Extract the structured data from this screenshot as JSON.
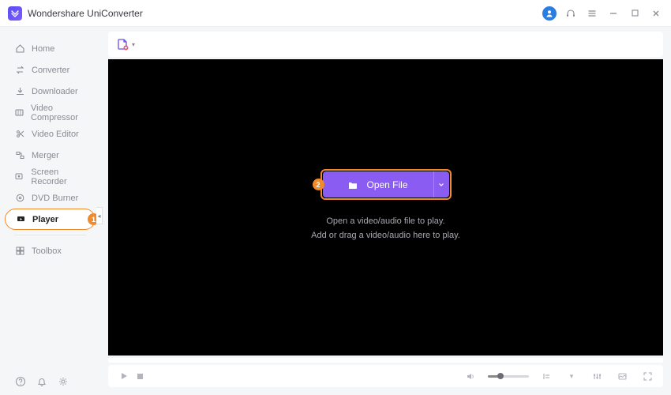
{
  "app": {
    "title": "Wondershare UniConverter"
  },
  "sidebar": {
    "items": [
      {
        "label": "Home",
        "icon": "home-icon"
      },
      {
        "label": "Converter",
        "icon": "converter-icon"
      },
      {
        "label": "Downloader",
        "icon": "download-icon"
      },
      {
        "label": "Video Compressor",
        "icon": "compress-icon"
      },
      {
        "label": "Video Editor",
        "icon": "scissors-icon"
      },
      {
        "label": "Merger",
        "icon": "merge-icon"
      },
      {
        "label": "Screen Recorder",
        "icon": "record-icon"
      },
      {
        "label": "DVD Burner",
        "icon": "disc-icon"
      },
      {
        "label": "Player",
        "icon": "player-icon",
        "active": true,
        "callout": "1"
      },
      {
        "label": "Toolbox",
        "icon": "toolbox-icon"
      }
    ]
  },
  "callouts": {
    "player": "1",
    "openfile": "2"
  },
  "stage": {
    "open_label": "Open File",
    "line1": "Open a video/audio file to play.",
    "line2": "Add or drag a video/audio here to play."
  },
  "colors": {
    "accent": "#8a5cf2",
    "highlight": "#f08a2a",
    "brand": "#5b4df1"
  }
}
